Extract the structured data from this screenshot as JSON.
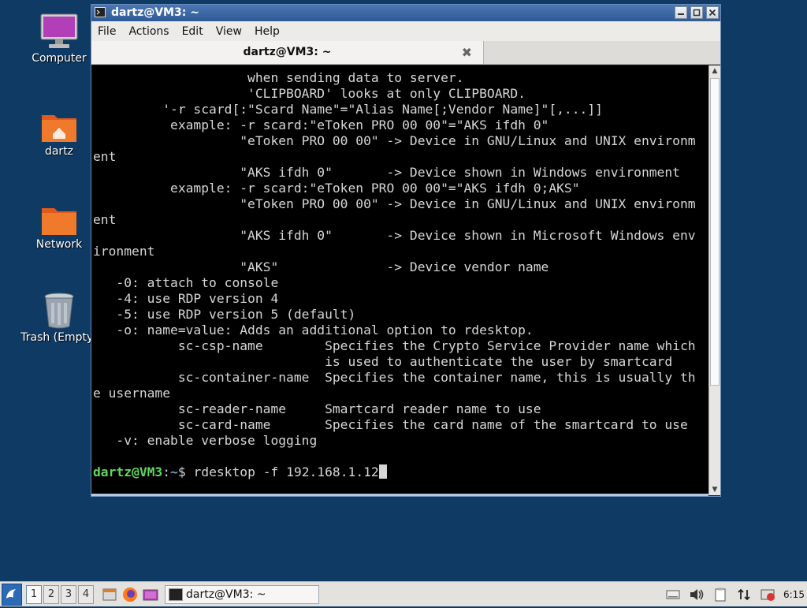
{
  "desktop": {
    "icons": [
      {
        "label": "Computer"
      },
      {
        "label": "dartz"
      },
      {
        "label": "Network"
      },
      {
        "label": "Trash (Empty)"
      }
    ]
  },
  "window": {
    "title": "dartz@VM3: ~",
    "buttons": {
      "minimize": "▫",
      "maximize": "▫",
      "close": "✕"
    },
    "menu": [
      "File",
      "Actions",
      "Edit",
      "View",
      "Help"
    ],
    "tab": {
      "label": "dartz@VM3: ~",
      "close": "✖"
    }
  },
  "terminal": {
    "lines": [
      "                    when sending data to server.",
      "                    'CLIPBOARD' looks at only CLIPBOARD.",
      "         '-r scard[:\"Scard Name\"=\"Alias Name[;Vendor Name]\"[,...]]",
      "          example: -r scard:\"eToken PRO 00 00\"=\"AKS ifdh 0\"",
      "                   \"eToken PRO 00 00\" -> Device in GNU/Linux and UNIX environm",
      "ent",
      "                   \"AKS ifdh 0\"       -> Device shown in Windows environment",
      "          example: -r scard:\"eToken PRO 00 00\"=\"AKS ifdh 0;AKS\"",
      "                   \"eToken PRO 00 00\" -> Device in GNU/Linux and UNIX environm",
      "ent",
      "                   \"AKS ifdh 0\"       -> Device shown in Microsoft Windows env",
      "ironment",
      "                   \"AKS\"              -> Device vendor name",
      "   -0: attach to console",
      "   -4: use RDP version 4",
      "   -5: use RDP version 5 (default)",
      "   -o: name=value: Adds an additional option to rdesktop.",
      "           sc-csp-name        Specifies the Crypto Service Provider name which",
      "                              is used to authenticate the user by smartcard",
      "           sc-container-name  Specifies the container name, this is usually th",
      "e username",
      "           sc-reader-name     Smartcard reader name to use",
      "           sc-card-name       Specifies the card name of the smartcard to use",
      "   -v: enable verbose logging",
      ""
    ],
    "prompt_user": "dartz@VM3",
    "prompt_sep": ":",
    "prompt_path": "~",
    "prompt_dollar": "$ ",
    "command": "rdesktop -f 192.168.1.12"
  },
  "taskbar": {
    "workspaces": [
      "1",
      "2",
      "3",
      "4"
    ],
    "active_workspace": "1",
    "task": {
      "label": "dartz@VM3: ~"
    },
    "clock": "6:15"
  },
  "colors": {
    "desktop_bg": "#0f3a64",
    "prompt_user": "#5fd75f",
    "prompt_path": "#729fcf"
  }
}
